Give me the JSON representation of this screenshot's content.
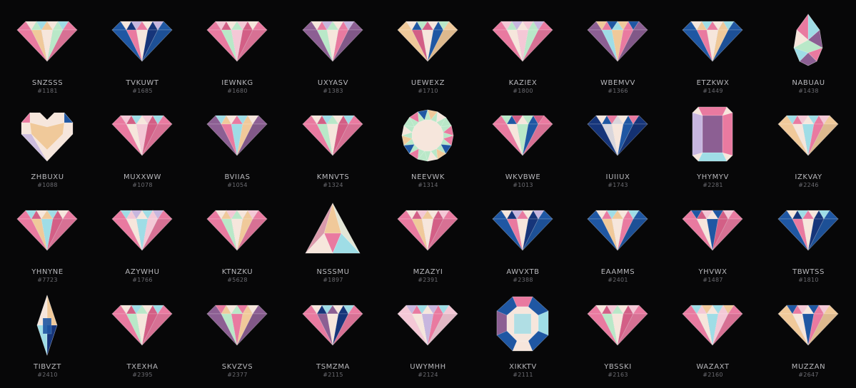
{
  "palette": {
    "background": "#070708",
    "pink": "#e97aa0",
    "rose": "#d35f86",
    "blush": "#f4c8d6",
    "mint": "#b9e8c8",
    "aqua": "#9fdde6",
    "blue": "#1f57a3",
    "navy": "#16357a",
    "purple": "#8c5f93",
    "peach": "#f0c99a",
    "cream": "#f6e6dc",
    "lilac": "#c7b6df",
    "grey": "#d9d6dc"
  },
  "items": [
    {
      "name": "SNZSSS",
      "id": "#1181",
      "shape": "diamond",
      "colors": [
        "pink",
        "mint",
        "peach",
        "cream",
        "aqua"
      ]
    },
    {
      "name": "TVKUWT",
      "id": "#1685",
      "shape": "diamond",
      "colors": [
        "blue",
        "navy",
        "pink",
        "cream",
        "lilac"
      ]
    },
    {
      "name": "IEWNKG",
      "id": "#1680",
      "shape": "diamond",
      "colors": [
        "pink",
        "rose",
        "mint",
        "blush",
        "cream"
      ]
    },
    {
      "name": "UXYASV",
      "id": "#1383",
      "shape": "diamond",
      "colors": [
        "purple",
        "pink",
        "mint",
        "cream",
        "lilac"
      ]
    },
    {
      "name": "UEWEXZ",
      "id": "#1710",
      "shape": "diamond",
      "colors": [
        "peach",
        "blue",
        "rose",
        "cream",
        "mint"
      ]
    },
    {
      "name": "KAZIEX",
      "id": "#1800",
      "shape": "diamond",
      "colors": [
        "pink",
        "mint",
        "cream",
        "blush",
        "lilac"
      ]
    },
    {
      "name": "WBEMVV",
      "id": "#1366",
      "shape": "diamond",
      "colors": [
        "purple",
        "pink",
        "aqua",
        "peach",
        "blue"
      ]
    },
    {
      "name": "ETZKWX",
      "id": "#1449",
      "shape": "diamond",
      "colors": [
        "blue",
        "peach",
        "pink",
        "cream",
        "aqua"
      ]
    },
    {
      "name": "NABUAU",
      "id": "#1438",
      "shape": "pear",
      "colors": [
        "mint",
        "pink",
        "aqua",
        "cream",
        "purple"
      ]
    },
    {
      "name": "ZHBUXU",
      "id": "#1088",
      "shape": "heart",
      "colors": [
        "peach",
        "pink",
        "blue",
        "cream",
        "lilac"
      ]
    },
    {
      "name": "MUXXWW",
      "id": "#1078",
      "shape": "diamond",
      "colors": [
        "pink",
        "rose",
        "cream",
        "blush",
        "aqua"
      ]
    },
    {
      "name": "BVIIAS",
      "id": "#1054",
      "shape": "diamond",
      "colors": [
        "purple",
        "peach",
        "pink",
        "aqua",
        "cream"
      ]
    },
    {
      "name": "KMNVTS",
      "id": "#1324",
      "shape": "diamond",
      "colors": [
        "pink",
        "rose",
        "mint",
        "cream",
        "aqua"
      ]
    },
    {
      "name": "NEEVWK",
      "id": "#1314",
      "shape": "round",
      "colors": [
        "mint",
        "pink",
        "blue",
        "peach",
        "cream"
      ]
    },
    {
      "name": "WKVBWE",
      "id": "#1013",
      "shape": "diamond",
      "colors": [
        "pink",
        "blue",
        "cream",
        "mint",
        "rose"
      ]
    },
    {
      "name": "IUIIUX",
      "id": "#1743",
      "shape": "diamond",
      "colors": [
        "navy",
        "blue",
        "grey",
        "cream",
        "pink"
      ]
    },
    {
      "name": "YHYMYV",
      "id": "#2281",
      "shape": "emerald",
      "colors": [
        "pink",
        "purple",
        "cream",
        "lilac",
        "aqua"
      ]
    },
    {
      "name": "IZKVAY",
      "id": "#2246",
      "shape": "diamond",
      "colors": [
        "peach",
        "pink",
        "cream",
        "aqua",
        "blush"
      ]
    },
    {
      "name": "YHNYNE",
      "id": "#7723",
      "shape": "diamond",
      "colors": [
        "pink",
        "rose",
        "peach",
        "aqua",
        "cream"
      ]
    },
    {
      "name": "AZYWHU",
      "id": "#1766",
      "shape": "diamond",
      "colors": [
        "pink",
        "blush",
        "cream",
        "aqua",
        "lilac"
      ]
    },
    {
      "name": "KTNZKU",
      "id": "#5628",
      "shape": "diamond",
      "colors": [
        "pink",
        "peach",
        "mint",
        "cream",
        "blush"
      ]
    },
    {
      "name": "NSSSMU",
      "id": "#1897",
      "shape": "trillion",
      "colors": [
        "mint",
        "peach",
        "pink",
        "cream",
        "aqua"
      ]
    },
    {
      "name": "MZAZYI",
      "id": "#2391",
      "shape": "diamond",
      "colors": [
        "pink",
        "rose",
        "peach",
        "cream",
        "blush"
      ]
    },
    {
      "name": "AWVXTB",
      "id": "#2388",
      "shape": "diamond",
      "colors": [
        "blue",
        "navy",
        "pink",
        "cream",
        "lilac"
      ]
    },
    {
      "name": "EAAMMS",
      "id": "#2401",
      "shape": "diamond",
      "colors": [
        "blue",
        "pink",
        "peach",
        "cream",
        "aqua"
      ]
    },
    {
      "name": "YHVWX",
      "id": "#1487",
      "shape": "diamond",
      "colors": [
        "pink",
        "rose",
        "cream",
        "blue",
        "blush"
      ]
    },
    {
      "name": "TBWTSS",
      "id": "#1810",
      "shape": "diamond",
      "colors": [
        "blue",
        "navy",
        "pink",
        "cream",
        "aqua"
      ]
    },
    {
      "name": "TIBVZT",
      "id": "#2410",
      "shape": "marquise",
      "colors": [
        "blue",
        "peach",
        "cream",
        "aqua",
        "navy"
      ]
    },
    {
      "name": "TXEXHA",
      "id": "#2395",
      "shape": "diamond",
      "colors": [
        "pink",
        "rose",
        "mint",
        "cream",
        "aqua"
      ]
    },
    {
      "name": "SKVZVS",
      "id": "#2377",
      "shape": "diamond",
      "colors": [
        "purple",
        "peach",
        "mint",
        "pink",
        "cream"
      ]
    },
    {
      "name": "TSMZMA",
      "id": "#2115",
      "shape": "diamond",
      "colors": [
        "pink",
        "navy",
        "purple",
        "cream",
        "aqua"
      ]
    },
    {
      "name": "UWYMHH",
      "id": "#2124",
      "shape": "diamond",
      "colors": [
        "blush",
        "pink",
        "cream",
        "lilac",
        "aqua"
      ]
    },
    {
      "name": "XIKKTV",
      "id": "#2111",
      "shape": "octagon",
      "colors": [
        "blue",
        "pink",
        "aqua",
        "cream",
        "purple"
      ]
    },
    {
      "name": "YBSSKI",
      "id": "#2163",
      "shape": "diamond",
      "colors": [
        "pink",
        "rose",
        "mint",
        "cream",
        "blush"
      ]
    },
    {
      "name": "WAZAXT",
      "id": "#2160",
      "shape": "diamond",
      "colors": [
        "pink",
        "blush",
        "cream",
        "aqua",
        "peach"
      ]
    },
    {
      "name": "MUZZAN",
      "id": "#2647",
      "shape": "diamond",
      "colors": [
        "peach",
        "pink",
        "cream",
        "blue",
        "blush"
      ]
    }
  ]
}
